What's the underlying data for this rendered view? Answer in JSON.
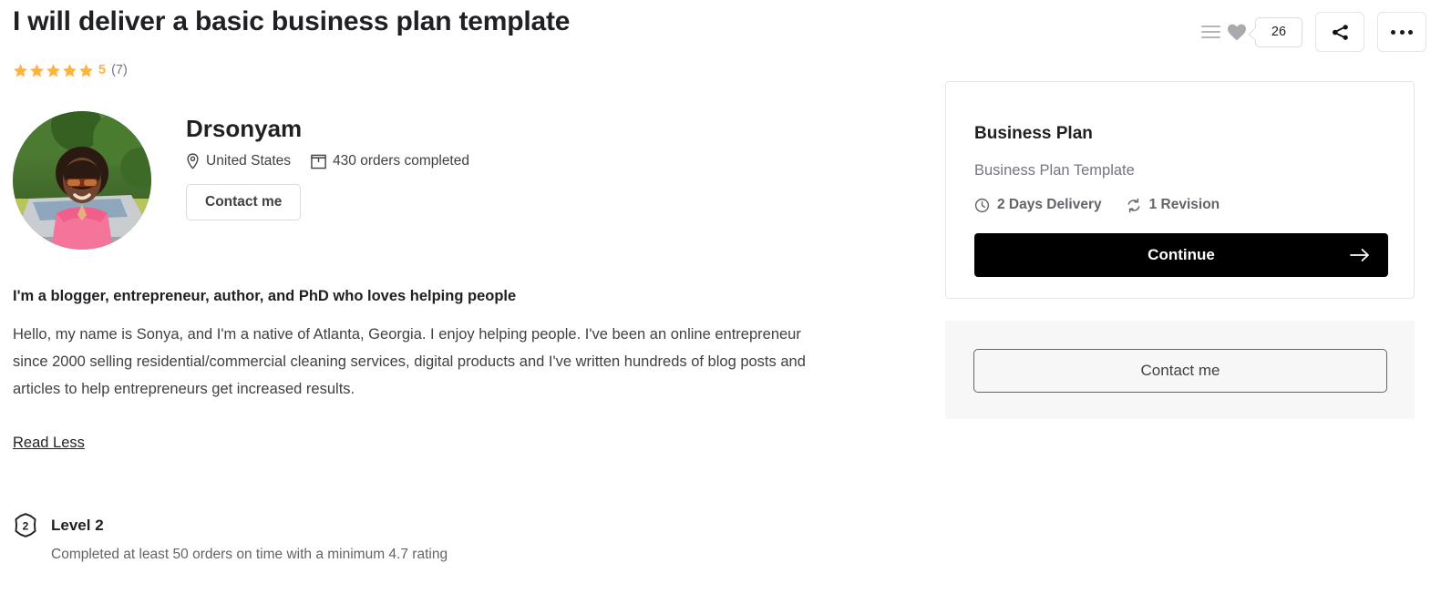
{
  "gig": {
    "title": "I will deliver a basic business plan template",
    "rating": {
      "score": "5",
      "count": "(7)",
      "stars_filled": 5,
      "star_color": "#ffb33e"
    }
  },
  "header_actions": {
    "collect_icon": "collect-lines-icon",
    "like_icon": "heart-icon",
    "like_count": "26",
    "share_icon": "share-icon",
    "more_icon": "more-options-icon"
  },
  "seller": {
    "name": "Drsonyam",
    "avatar_alt": "seller-profile-photo",
    "location": "United States",
    "location_icon": "location-pin-icon",
    "orders": "430 orders completed",
    "orders_icon": "package-box-icon",
    "contact_label": "Contact me"
  },
  "bio": {
    "heading": "I'm a blogger, entrepreneur, author, and PhD who loves helping people",
    "body": "Hello, my name is Sonya, and I'm a native of Atlanta, Georgia. I enjoy helping people. I've been an online entrepreneur since 2000 selling residential/commercial cleaning services, digital products and I've written hundreds of blog posts and articles to help entrepreneurs get increased results.",
    "toggle_label": "Read Less"
  },
  "level": {
    "badge_number": "2",
    "title": "Level 2",
    "description": "Completed at least 50 orders on time with a minimum 4.7 rating"
  },
  "package": {
    "title": "Business Plan",
    "subtitle": "Business Plan Template",
    "delivery": "2 Days Delivery",
    "delivery_icon": "clock-icon",
    "revisions": "1 Revision",
    "revisions_icon": "revision-refresh-icon",
    "continue_label": "Continue",
    "continue_arrow_icon": "arrow-right-icon"
  },
  "contact_panel": {
    "button_label": "Contact me"
  },
  "colors": {
    "accent_star": "#ffb33e",
    "cta_background": "#000000",
    "panel_background": "#f7f7f7",
    "border": "#e4e5e7",
    "text_primary": "#1f2023",
    "text_secondary": "#74767e"
  }
}
